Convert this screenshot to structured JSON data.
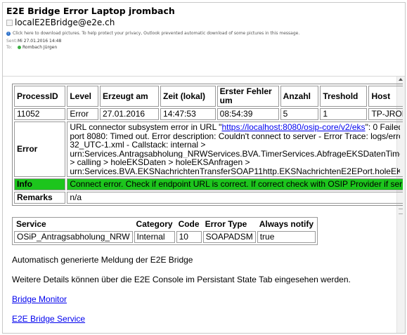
{
  "header": {
    "subject": "E2E Bridge Error Laptop jrombach",
    "from": "localE2EBridge@e2e.ch",
    "info_bar": "Click here to download pictures. To help protect your privacy, Outlook prevented automatic download of some pictures in this message.",
    "sent_label": "Sent:",
    "sent_value": "Mi 27.01.2016 14:48",
    "to_label": "To:",
    "to_value": "Rombach Jürgen"
  },
  "error_table": {
    "headers": {
      "process_id": "ProcessID",
      "level": "Level",
      "created": "Erzeugt am",
      "time": "Zeit (lokal)",
      "first_error": "Erster Fehler um",
      "count": "Anzahl",
      "threshold": "Treshold",
      "host": "Host"
    },
    "row": {
      "process_id": "11052",
      "level": "Error",
      "created": "27.01.2016",
      "time": "14:47:53",
      "first_error": "08:54:39",
      "count": "5",
      "threshold": "1",
      "host": "TP-JROMBA"
    },
    "error_label": "Error",
    "error_line1_pre": "URL connector subsystem error in URL \"",
    "error_link": "https://localhost:8080/osip-core/v2/eks",
    "error_line1_post": "\": 0 Failed",
    "error_line2": "port 8080: Timed out. Error description: Couldn't connect to server - Error Trace: logs/erro",
    "error_line3": "32_UTC-1.xml - Callstack: internal >",
    "error_line4": "urn:Services.Antragsabholung_NRWServices.BVA.TimerServices.AbfrageEKSDatenTimer",
    "error_line5": "> calling > holeEKSDaten > holeEKSAnfragen >",
    "error_line6": "urn:Services.BVA.EKSNachrichtenTransferSOAP11http.EKSNachrichtenE2EPort.holeEKS",
    "info_label": "Info",
    "info_text": "Connect error. Check if endpoint URL is correct. If correct check with OSIP Provider if ser",
    "remarks_label": "Remarks",
    "remarks_value": "n/a"
  },
  "service_table": {
    "headers": {
      "service": "Service",
      "category": "Category",
      "code": "Code",
      "error_type": "Error Type",
      "always_notify": "Always notify"
    },
    "row": {
      "service": "OSiP_Antragsabholung_NRW",
      "category": "Internal",
      "code": "10",
      "error_type": "SOAPADSM",
      "always_notify": "true"
    }
  },
  "footer": {
    "line1": "Automatisch generierte Meldung der E2E Bridge",
    "line2": "Weitere Details können über die E2E Console im Persistant State Tab eingesehen werden.",
    "link1": "Bridge Monitor",
    "link2": "E2E Bridge Service"
  },
  "colors": {
    "info_row": "#1dc51d",
    "link": "#0000ee"
  }
}
